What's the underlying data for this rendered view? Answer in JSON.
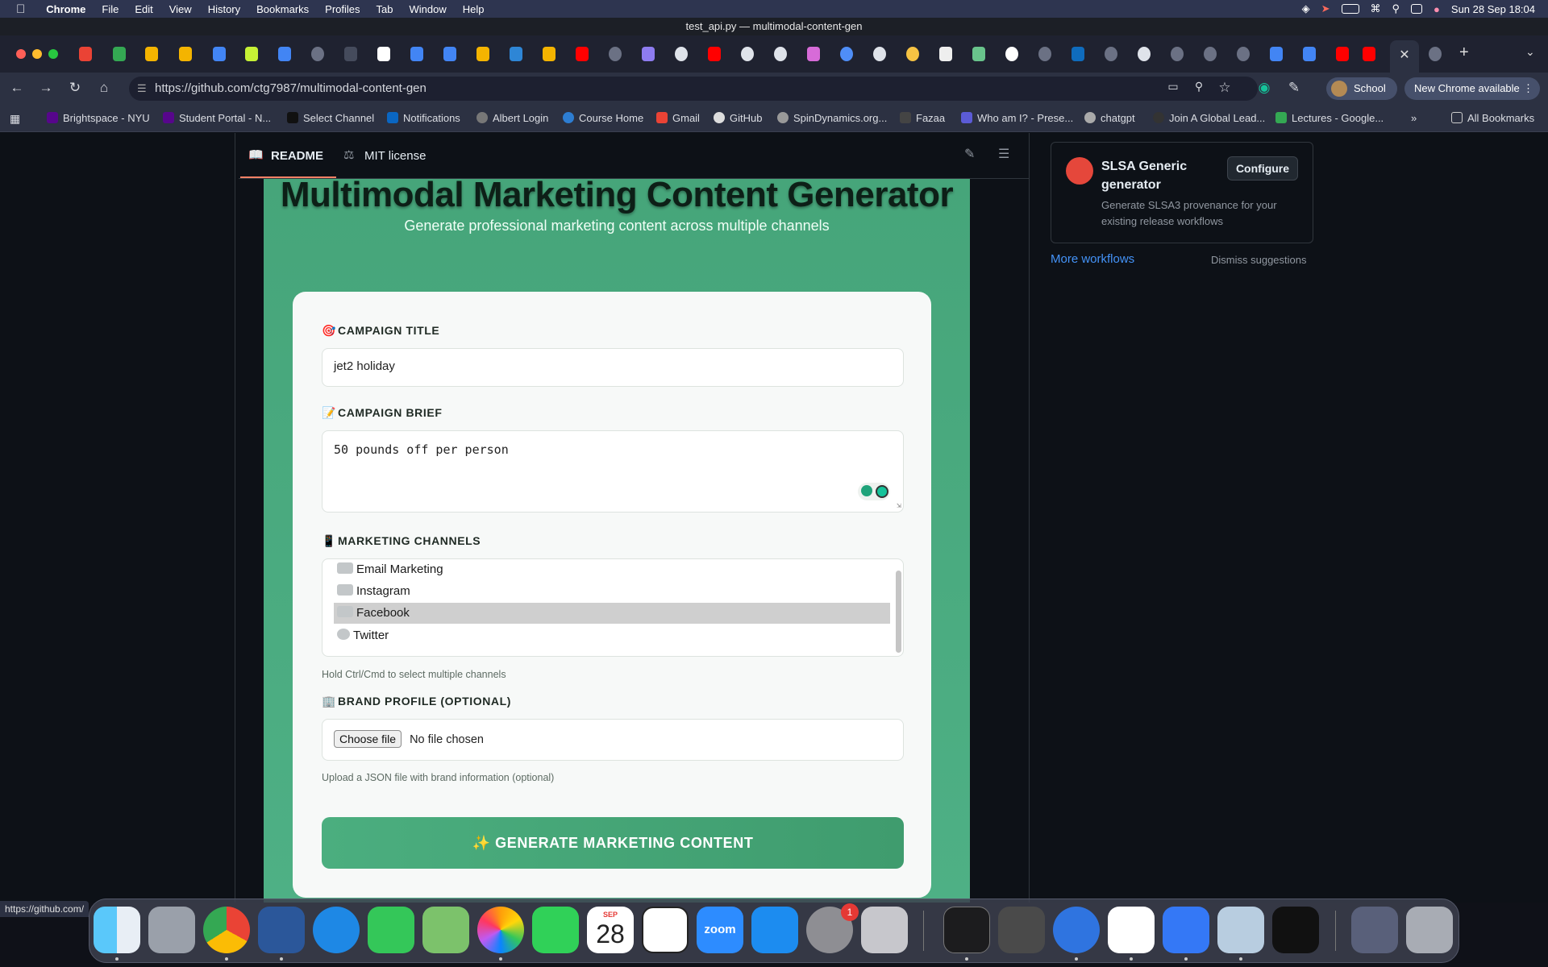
{
  "menubar": {
    "app": "Chrome",
    "items": [
      "File",
      "Edit",
      "View",
      "History",
      "Bookmarks",
      "Profiles",
      "Tab",
      "Window",
      "Help"
    ],
    "clock": "Sun 28 Sep  18:04"
  },
  "window_title": "test_api.py — multimodal-content-gen",
  "address": {
    "url": "https://github.com/ctg7987/multimodal-content-gen",
    "profile": "School",
    "update_label": "New Chrome available"
  },
  "bookmarks": {
    "items": [
      "Brightspace - NYU",
      "Student Portal - N...",
      "Select Channel",
      "Notifications",
      "Albert Login",
      "Course Home",
      "Gmail",
      "GitHub",
      "SpinDynamics.org...",
      "Fazaa",
      "Who am I? - Prese...",
      "chatgpt",
      "Join A Global Lead...",
      "Lectures - Google..."
    ],
    "all_label": "All Bookmarks"
  },
  "repo": {
    "readme_tab": "README",
    "license_tab": "MIT license"
  },
  "app": {
    "title": "Multimodal Marketing Content Generator",
    "subtitle": "Generate professional marketing content across multiple channels",
    "campaign_title_label": "CAMPAIGN TITLE",
    "campaign_title_value": "jet2 holiday",
    "brief_label": "CAMPAIGN BRIEF",
    "brief_value": "50 pounds off per person",
    "channels_label": "MARKETING CHANNELS",
    "channels": [
      {
        "label": "Email Marketing",
        "selected": false
      },
      {
        "label": "Instagram",
        "selected": false
      },
      {
        "label": "Facebook",
        "selected": true
      },
      {
        "label": "Twitter",
        "selected": false
      }
    ],
    "channels_hint": "Hold Ctrl/Cmd to select multiple channels",
    "brand_label": "BRAND PROFILE (OPTIONAL)",
    "choose_file": "Choose file",
    "no_file": "No file chosen",
    "brand_hint": "Upload a JSON file with brand information (optional)",
    "generate_label": "✨ GENERATE MARKETING CONTENT"
  },
  "sidebar": {
    "workflow_name": "SLSA Generic generator",
    "workflow_desc": "Generate SLSA3 provenance for your existing release workflows",
    "configure_label": "Configure",
    "more_label": "More workflows",
    "dismiss_label": "Dismiss suggestions"
  },
  "status_url": "https://github.com/",
  "dock": {
    "calendar_month": "SEP",
    "calendar_day": "28",
    "zoom_label": "zoom",
    "settings_badge": "1"
  },
  "colors": {
    "app_green": "#4eb085",
    "button_green": "#3f9c6e",
    "github_bg": "#0d1117",
    "link_blue": "#4493f8",
    "tab_underline": "#f78166"
  }
}
